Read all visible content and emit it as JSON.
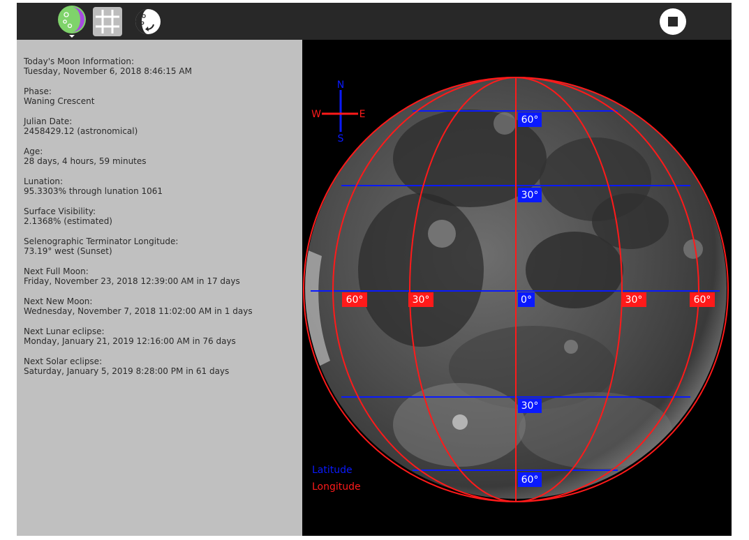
{
  "toolbar": {
    "moon_button_icon": "moon-view-icon",
    "grid_button_icon": "grid-icon",
    "rotate_button_icon": "rotate-moon-icon",
    "stop_button_icon": "stop-icon"
  },
  "info": [
    {
      "label": "Today's Moon Information:",
      "value": "Tuesday, November 6, 2018 8:46:15 AM"
    },
    {
      "label": "Phase:",
      "value": "Waning Crescent"
    },
    {
      "label": "Julian Date:",
      "value": "2458429.12 (astronomical)"
    },
    {
      "label": "Age:",
      "value": "28 days, 4 hours, 59 minutes"
    },
    {
      "label": "Lunation:",
      "value": "95.3303% through lunation 1061"
    },
    {
      "label": "Surface Visibility:",
      "value": "2.1368% (estimated)"
    },
    {
      "label": "Selenographic Terminator Longitude:",
      "value": "73.19° west (Sunset)"
    },
    {
      "label": "Next Full Moon:",
      "value": "Friday, November 23, 2018 12:39:00 AM in 17 days"
    },
    {
      "label": "Next New Moon:",
      "value": "Wednesday, November 7, 2018 11:02:00 AM in 1 days"
    },
    {
      "label": "Next Lunar eclipse:",
      "value": "Monday, January 21, 2019 12:16:00 AM in 76 days"
    },
    {
      "label": "Next Solar eclipse:",
      "value": "Saturday, January 5, 2019 8:28:00 PM in 61 days"
    }
  ],
  "compass": {
    "north": "N",
    "south": "S",
    "west": "W",
    "east": "E"
  },
  "grid": {
    "latitude_labels": [
      "60°",
      "30°",
      "30°",
      "60°"
    ],
    "longitude_labels": [
      "60°",
      "30°",
      "0°",
      "30°",
      "60°"
    ]
  },
  "legend": {
    "latitude": "Latitude",
    "longitude": "Longitude"
  },
  "colors": {
    "latitude": "#0a1aff",
    "longitude": "#ff1a1a",
    "toolbar": "#282828",
    "panel": "#c0c0c0",
    "panel_text": "#2a2a2a"
  }
}
